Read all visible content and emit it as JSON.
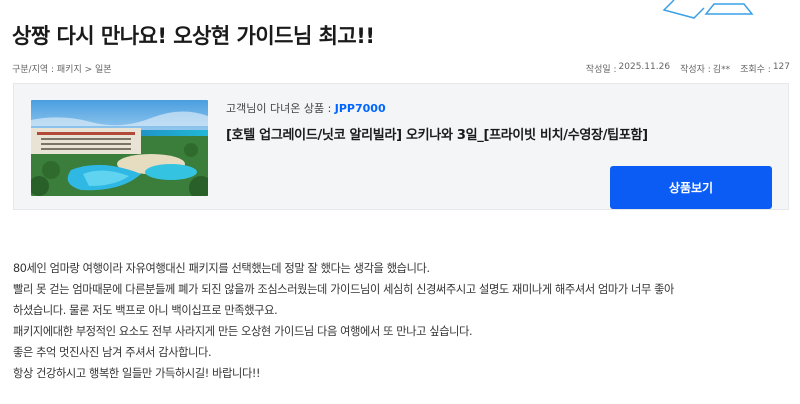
{
  "post": {
    "title": "상짱 다시 만나요! 오상현 가이드님 최고!!",
    "breadcrumb": "구분/지역 : 패키지 > 일본",
    "written_date_label": "작성일 :",
    "written_date": "2025.11.26",
    "author_label": "작성자 :",
    "author": "김**",
    "views_label": "조회수 :",
    "views": "127"
  },
  "product": {
    "code_label": "고객님이 다녀온 상품 :",
    "code": "JPP7000",
    "name": "[호텔 업그레이드/닛코 알리빌라] 오키나와 3일_[프라이빗 비치/수영장/팁포함]",
    "button_label": "상품보기",
    "accent_color": "#0a5cf5"
  },
  "review_lines": [
    " 80세인 엄마랑 여행이라 자유여행대신 패키지를 선택했는데 정말 잘 했다는 생각을 했습니다.",
    "빨리 못 걷는 엄마때문에 다른분들께 폐가 되진 않을까 조심스러웠는데 가이드님이 세심히 신경써주시고 설명도 재미나게 해주셔서 엄마가 너무 좋아",
    "하셨습니다. 물론 저도 백프로 아니 백이십프로 만족했구요.",
    "패키지에대한 부정적인 요소도 전부 사라지게 만든 오상현 가이드님  다음 여행에서 또 만나고 싶습니다.",
    "좋은 추억 멋진사진 남겨 주셔서 감사합니다.",
    "항상 건강하시고 행복한 일들만 가득하시길! 바랍니다!!"
  ]
}
